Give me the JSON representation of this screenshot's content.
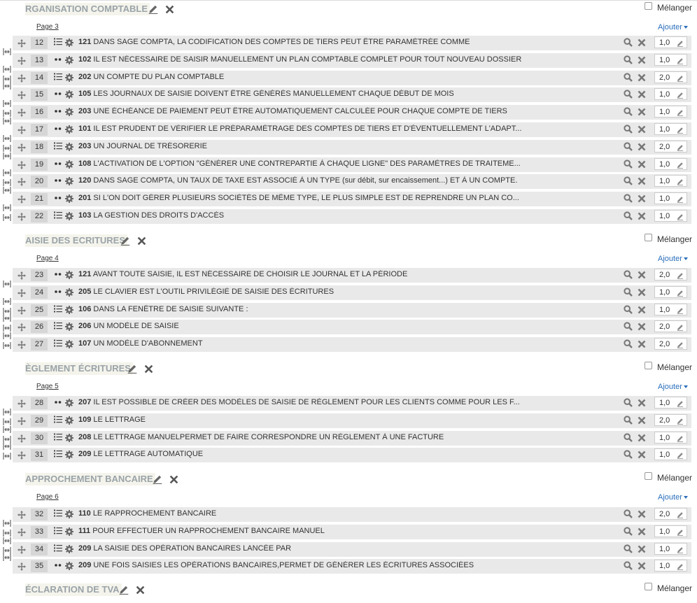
{
  "common": {
    "melanger_label": "Mélanger",
    "ajouter_label": "Ajouter"
  },
  "sections": [
    {
      "title": "RGANISATION COMPTABLE",
      "page_label": "Page 3",
      "questions": [
        {
          "num": "12",
          "type": "list",
          "code": "121",
          "text": "DANS SAGE COMPTA, LA CODIFICATION DES COMPTES DE TIERS PEUT ÊTRE PARAMÉTRÉE COMME",
          "score": "1,0"
        },
        {
          "num": "13",
          "type": "dots",
          "code": "102",
          "text": "IL EST NÉCESSAIRE DE SAISIR MANUELLEMENT UN PLAN COMPTABLE COMPLET POUR TOUT NOUVEAU DOSSIER",
          "score": "1,0"
        },
        {
          "num": "14",
          "type": "list",
          "code": "202",
          "text": "UN COMPTE DU PLAN COMPTABLE",
          "score": "2,0"
        },
        {
          "num": "15",
          "type": "dots",
          "code": "105",
          "text": "LES JOURNAUX DE SAISIE DOIVENT ÊTRE GÉNÉRÉS MANUELLEMENT CHAQUE DÉBUT DE MOIS",
          "score": "1,0"
        },
        {
          "num": "16",
          "type": "dots",
          "code": "203",
          "text": "UNE ÉCHÉANCE DE PAIEMENT PEUT ÊTRE AUTOMATIQUEMENT CALCULÉE POUR CHAQUE COMPTE DE TIERS",
          "score": "1,0"
        },
        {
          "num": "17",
          "type": "dots",
          "code": "101",
          "text": "IL EST PRUDENT DE VÉRIFIER LE PRÉPARAMÉTRAGE DES COMPTES DE TIERS ET D'ÉVENTUELLEMENT L'ADAPT...",
          "score": "1,0"
        },
        {
          "num": "18",
          "type": "list",
          "code": "203",
          "text": "UN JOURNAL DE TRÉSORERIE",
          "score": "2,0"
        },
        {
          "num": "19",
          "type": "dots",
          "code": "108",
          "text": "L'ACTIVATION DE L'OPTION \"GÉNÉRER UNE CONTREPARTIE À CHAQUE LIGNE\" DES PARAMÈTRES DE TRAITEME...",
          "score": "1,0"
        },
        {
          "num": "20",
          "type": "dots",
          "code": "120",
          "text": "DANS SAGE COMPTA, UN TAUX DE TAXE EST ASSOCIÉ À UN TYPE (sur débit, sur encaissement...) ET À UN COMPTE.",
          "score": "1,0"
        },
        {
          "num": "21",
          "type": "dots",
          "code": "201",
          "text": "SI L'ON DOIT GÉRER PLUSIEURS SOCIÉTÉS DE MÊME TYPE, LE PLUS SIMPLE EST DE REPRENDRE UN PLAN CO...",
          "score": "1,0"
        },
        {
          "num": "22",
          "type": "list",
          "code": "103",
          "text": "LA GESTION DES DROITS D'ACCÈS",
          "score": "1,0"
        }
      ]
    },
    {
      "title": "AISIE DES ECRITURES",
      "page_label": "Page 4",
      "questions": [
        {
          "num": "23",
          "type": "dots",
          "code": "121",
          "text": "AVANT TOUTE SAISIE, IL EST NÉCESSAIRE DE CHOISIR LE JOURNAL ET LA PÉRIODE",
          "score": "2,0"
        },
        {
          "num": "24",
          "type": "dots",
          "code": "205",
          "text": "LE CLAVIER EST L'OUTIL PRIVILÉGIÉ DE SAISIE DES ÉCRITURES",
          "score": "1,0"
        },
        {
          "num": "25",
          "type": "list",
          "code": "106",
          "text": "DANS LA FENÊTRE DE SAISIE SUIVANTE :",
          "score": "1,0"
        },
        {
          "num": "26",
          "type": "list",
          "code": "206",
          "text": "UN MODÈLE DE SAISIE",
          "score": "2,0"
        },
        {
          "num": "27",
          "type": "list",
          "code": "107",
          "text": "UN MODÈLE D'ABONNEMENT",
          "score": "2,0"
        }
      ]
    },
    {
      "title": "ÈGLEMENT ÉCRITURES",
      "page_label": "Page 5",
      "questions": [
        {
          "num": "28",
          "type": "dots",
          "code": "207",
          "text": "IL EST POSSIBLE DE CRÉER DES MODÈLES DE SAISIE DE RÈGLEMENT POUR LES CLIENTS COMME POUR LES F...",
          "score": "1,0"
        },
        {
          "num": "29",
          "type": "list",
          "code": "109",
          "text": "LE LETTRAGE",
          "score": "2,0"
        },
        {
          "num": "30",
          "type": "list",
          "code": "208",
          "text": "LE LETTRAGE MANUELPERMET DE FAIRE CORRESPONDRE UN RÈGLEMENT À UNE FACTURE",
          "score": "1,0"
        },
        {
          "num": "31",
          "type": "list",
          "code": "209",
          "text": "LE LETTRAGE AUTOMATIQUE",
          "score": "1,0"
        }
      ]
    },
    {
      "title": "APPROCHEMENT BANCAIRE",
      "page_label": "Page 6",
      "questions": [
        {
          "num": "32",
          "type": "list",
          "code": "110",
          "text": "LE RAPPROCHEMENT BANCAIRE",
          "score": "2,0"
        },
        {
          "num": "33",
          "type": "list",
          "code": "111",
          "text": "POUR EFFECTUER UN RAPPROCHEMENT BANCAIRE MANUEL",
          "score": "1,0"
        },
        {
          "num": "34",
          "type": "list",
          "code": "209",
          "text": "LA SAISIE DES OPÉRATION BANCAIRES LANCÉE PAR",
          "score": "1,0"
        },
        {
          "num": "35",
          "type": "dots",
          "code": "209",
          "text": "UNE FOIS SAISIES LES OPÉRATIONS BANCAIRES,PERMET DE GÉNÉRER LES ÉCRITURES ASSOCIÉES",
          "score": "1,0"
        }
      ]
    },
    {
      "title": "ÉCLARATION DE TVA",
      "page_label": "",
      "questions": []
    }
  ]
}
